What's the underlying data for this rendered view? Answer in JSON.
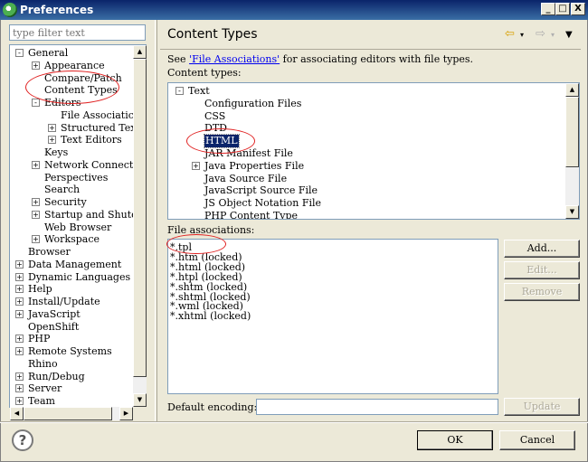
{
  "window": {
    "title": "Preferences",
    "minimize": "_",
    "maximize": "□",
    "close": "X"
  },
  "left": {
    "filter_placeholder": "type filter text",
    "tree": [
      {
        "label": "General",
        "expander": "-"
      },
      {
        "label": "Appearance",
        "expander": "+"
      },
      {
        "label": "Compare/Patch",
        "expander": ""
      },
      {
        "label": "Content Types",
        "expander": ""
      },
      {
        "label": "Editors",
        "expander": "-"
      },
      {
        "label": "File Associatic",
        "expander": ""
      },
      {
        "label": "Structured Text",
        "expander": "+"
      },
      {
        "label": "Text Editors",
        "expander": "+"
      },
      {
        "label": "Keys",
        "expander": ""
      },
      {
        "label": "Network Connection",
        "expander": "+"
      },
      {
        "label": "Perspectives",
        "expander": ""
      },
      {
        "label": "Search",
        "expander": ""
      },
      {
        "label": "Security",
        "expander": "+"
      },
      {
        "label": "Startup and Shutdo",
        "expander": "+"
      },
      {
        "label": "Web Browser",
        "expander": ""
      },
      {
        "label": "Workspace",
        "expander": "+"
      },
      {
        "label": "Browser",
        "expander": ""
      },
      {
        "label": "Data Management",
        "expander": "+"
      },
      {
        "label": "Dynamic Languages",
        "expander": "+"
      },
      {
        "label": "Help",
        "expander": "+"
      },
      {
        "label": "Install/Update",
        "expander": "+"
      },
      {
        "label": "JavaScript",
        "expander": "+"
      },
      {
        "label": "OpenShift",
        "expander": ""
      },
      {
        "label": "PHP",
        "expander": "+"
      },
      {
        "label": "Remote Systems",
        "expander": "+"
      },
      {
        "label": "Rhino",
        "expander": ""
      },
      {
        "label": "Run/Debug",
        "expander": "+"
      },
      {
        "label": "Server",
        "expander": "+"
      },
      {
        "label": "Team",
        "expander": "+"
      }
    ]
  },
  "page": {
    "title": "Content Types",
    "see_prefix": "See ",
    "see_link": "'File Associations'",
    "see_suffix": " for associating editors with file types.",
    "content_types_label": "Content types:",
    "content_types": [
      {
        "label": "Text",
        "expander": "-"
      },
      {
        "label": "Configuration Files",
        "expander": ""
      },
      {
        "label": "CSS",
        "expander": ""
      },
      {
        "label": "DTD",
        "expander": ""
      },
      {
        "label": "HTML",
        "expander": ""
      },
      {
        "label": "JAR Manifest File",
        "expander": ""
      },
      {
        "label": "Java Properties File",
        "expander": "+"
      },
      {
        "label": "Java Source File",
        "expander": ""
      },
      {
        "label": "JavaScript Source File",
        "expander": ""
      },
      {
        "label": "JS Object Notation File",
        "expander": ""
      },
      {
        "label": "PHP Content Type",
        "expander": ""
      }
    ],
    "file_associations_label": "File associations:",
    "file_associations": [
      "*.tpl",
      "*.htm (locked)",
      "*.html (locked)",
      "*.htpl (locked)",
      "*.shtm (locked)",
      "*.shtml (locked)",
      "*.wml (locked)",
      "*.xhtml (locked)"
    ],
    "buttons": {
      "add": "Add...",
      "edit": "Edit...",
      "remove": "Remove",
      "update": "Update"
    },
    "encoding_label": "Default encoding:",
    "encoding_value": ""
  },
  "footer": {
    "help": "?",
    "ok": "OK",
    "cancel": "Cancel"
  }
}
